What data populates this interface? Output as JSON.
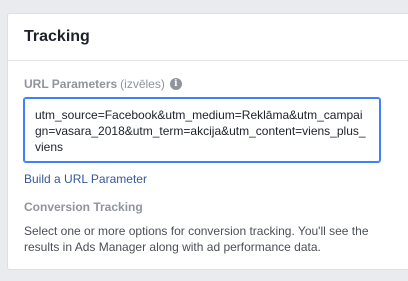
{
  "card": {
    "title": "Tracking",
    "url_parameters": {
      "label": "URL Parameters",
      "optional_label": "(izvēles)",
      "value": "utm_source=Facebook&utm_medium=Reklāma&utm_campaign=vasara_2018&utm_term=akcija&utm_content=viens_plus_viens"
    },
    "build_link": "Build a URL Parameter",
    "conversion": {
      "title": "Conversion Tracking",
      "description": "Select one or more options for conversion tracking. You'll see the results in Ads Manager along with ad performance data."
    }
  },
  "icons": {
    "info": "info-icon"
  },
  "colors": {
    "accent": "#4080ff",
    "link": "#365899"
  }
}
